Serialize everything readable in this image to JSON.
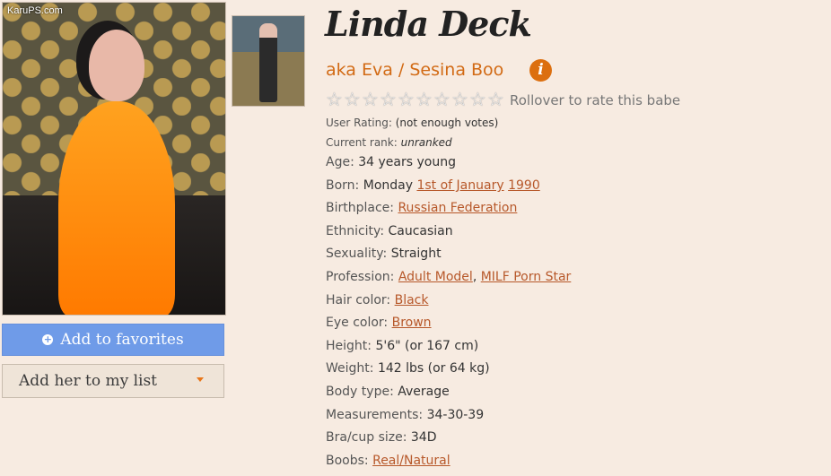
{
  "photo": {
    "watermark": "KaruPS.com"
  },
  "buttons": {
    "favorites_icon": "plus-circle-icon",
    "favorites_label": "Add to favorites",
    "list_label": "Add her to my list",
    "list_caret_icon": "caret-down-icon"
  },
  "profile": {
    "name": "Linda Deck",
    "aka": "aka Eva / Sesina Boo",
    "info_icon_glyph": "i",
    "rating_prompt": "Rollover to rate this babe",
    "user_rating_label": "User Rating:",
    "user_rating_value": "(not enough votes)",
    "rank_label": "Current rank:",
    "rank_value": "unranked"
  },
  "details": {
    "age": {
      "label": "Age:",
      "value": "34 years young"
    },
    "born": {
      "label": "Born:",
      "day": "Monday",
      "date_link": "1st of January",
      "year_link": "1990"
    },
    "birthplace": {
      "label": "Birthplace:",
      "link": "Russian Federation"
    },
    "ethnicity": {
      "label": "Ethnicity:",
      "value": "Caucasian"
    },
    "sexuality": {
      "label": "Sexuality:",
      "value": "Straight"
    },
    "profession": {
      "label": "Profession:",
      "link1": "Adult Model",
      "sep": ",",
      "link2": "MILF Porn Star"
    },
    "hair": {
      "label": "Hair color:",
      "link": "Black"
    },
    "eye": {
      "label": "Eye color:",
      "link": "Brown"
    },
    "height": {
      "label": "Height:",
      "value": "5'6\" (or 167 cm)"
    },
    "weight": {
      "label": "Weight:",
      "value": "142 lbs (or 64 kg)"
    },
    "body": {
      "label": "Body type:",
      "value": "Average"
    },
    "measurements": {
      "label": "Measurements:",
      "value": "34-30-39"
    },
    "bra": {
      "label": "Bra/cup size:",
      "value": "34D"
    },
    "boobs": {
      "label": "Boobs:",
      "link": "Real/Natural"
    }
  },
  "colors": {
    "background": "#f7ebe1",
    "accent_orange": "#d26a14",
    "link": "#b7582a",
    "favorites_button": "#6f9be8"
  }
}
